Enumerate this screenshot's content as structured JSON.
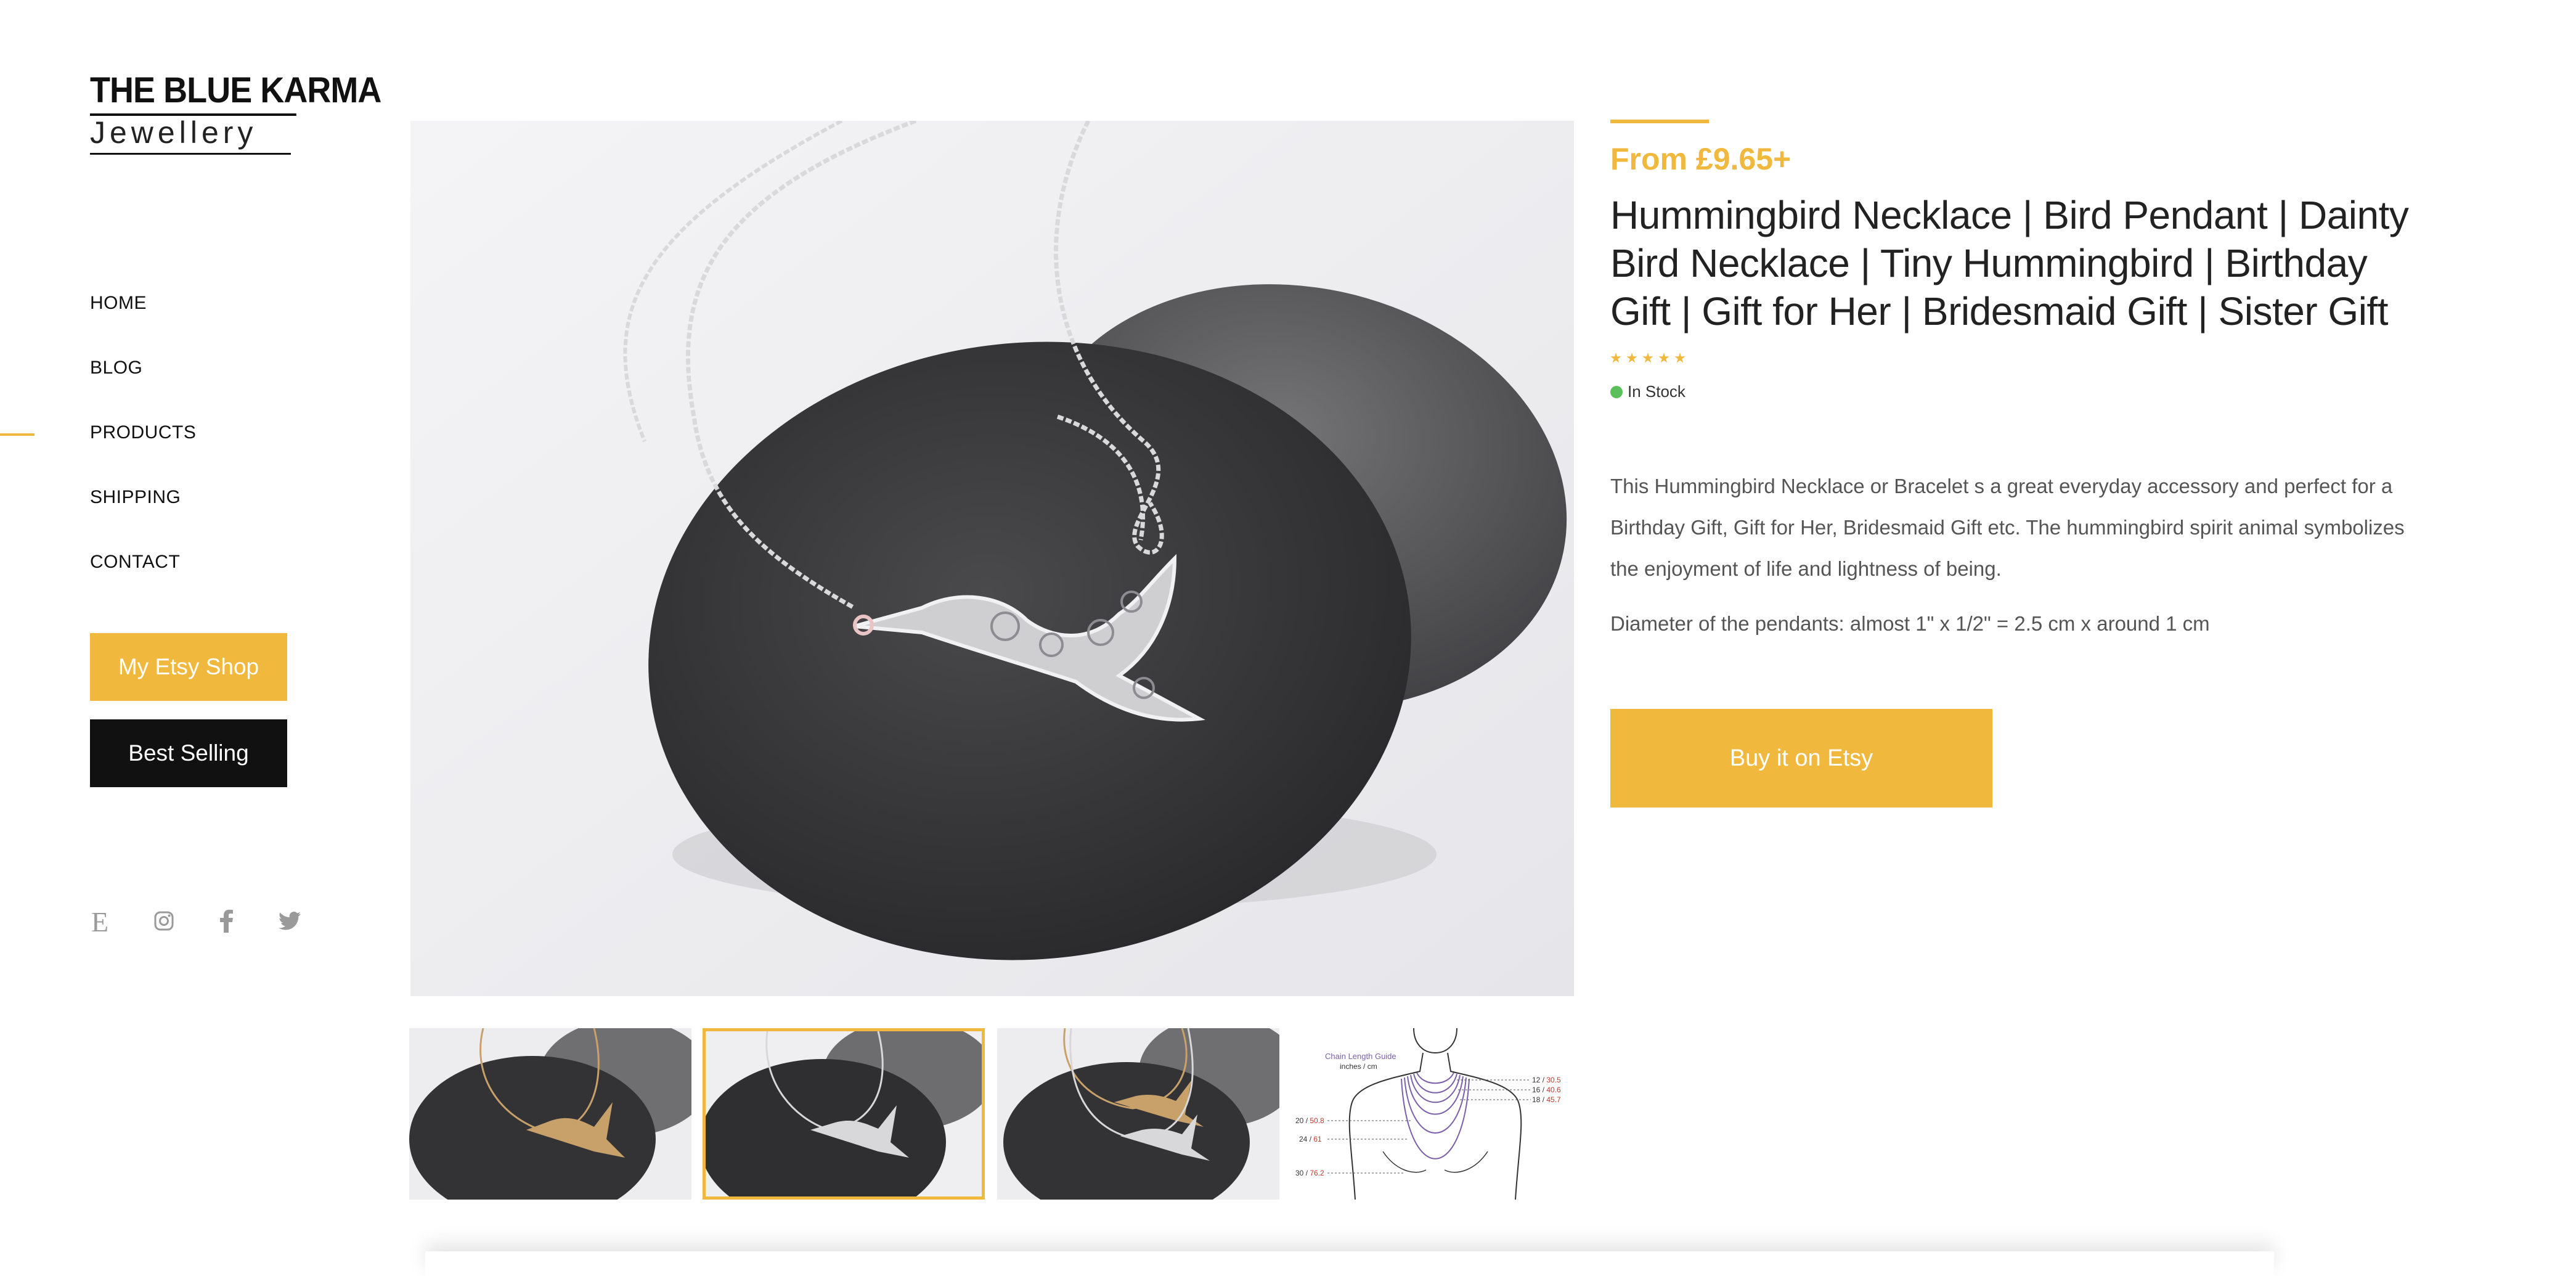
{
  "brand": {
    "name_top": "THE BLUE KARMA",
    "name_bottom": "Jewellery"
  },
  "nav": [
    {
      "label": "HOME",
      "active": false
    },
    {
      "label": "BLOG",
      "active": false
    },
    {
      "label": "PRODUCTS",
      "active": true
    },
    {
      "label": "SHIPPING",
      "active": false
    },
    {
      "label": "CONTACT",
      "active": false
    }
  ],
  "sidebar_buttons": {
    "etsy_shop": "My Etsy Shop",
    "best_selling": "Best Selling"
  },
  "social": [
    "etsy-icon",
    "instagram-icon",
    "facebook-icon",
    "twitter-icon"
  ],
  "product": {
    "price": "From £9.65+",
    "title": "Hummingbird Necklace | Bird Pendant | Dainty Bird Necklace | Tiny Hummingbird | Birthday Gift | Gift for Her | Bridesmaid Gift | Sister Gift",
    "rating_stars": 5,
    "stock": "In Stock",
    "description": "This Hummingbird Necklace or Bracelet s a great everyday accessory and perfect for a Birthday Gift, Gift for Her, Bridesmaid Gift etc. The hummingbird spirit animal symbolizes the enjoyment of life and lightness of being.",
    "diameter": "Diameter of the pendants: almost 1\" x 1/2\" = 2.5 cm x around 1 cm",
    "buy_label": "Buy it on Etsy"
  },
  "gallery": {
    "selected_index": 1,
    "chain_guide": {
      "title": "Chain Length Guide",
      "subtitle": "inches / cm",
      "right_marks": [
        {
          "in": "12",
          "cm": "30.5"
        },
        {
          "in": "16",
          "cm": "40.6"
        },
        {
          "in": "18",
          "cm": "45.7"
        }
      ],
      "left_marks": [
        {
          "in": "20",
          "cm": "50.8"
        },
        {
          "in": "24",
          "cm": "61"
        },
        {
          "in": "30",
          "cm": "76.2"
        }
      ]
    }
  },
  "colors": {
    "accent": "#f0b93e",
    "dark": "#111111",
    "in_stock": "#5bc05b"
  }
}
